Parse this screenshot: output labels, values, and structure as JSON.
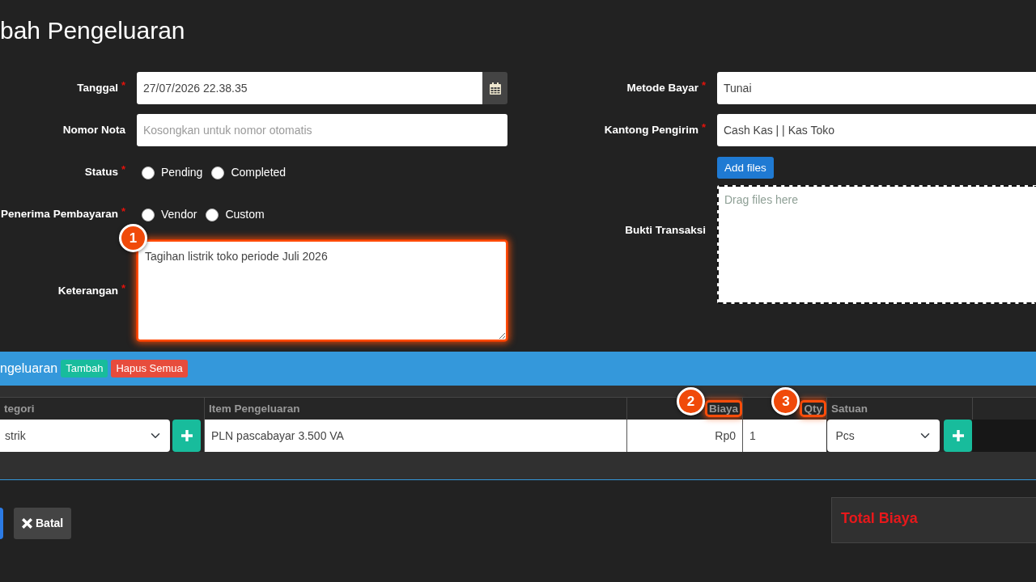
{
  "page_title": "bah Pengeluaran",
  "form_left": [
    {
      "kind": "datetime",
      "label": "Tanggal",
      "required_mark": "*",
      "value": "27/07/2026 22.38.35"
    },
    {
      "kind": "text",
      "label": "Nomor Nota",
      "placeholder": "Kosongkan untuk nomor otomatis"
    },
    {
      "kind": "radio",
      "label": "Status",
      "required_mark": "*",
      "options": [
        {
          "label": "Pending",
          "selected": false
        },
        {
          "label": "Completed",
          "selected": false
        }
      ]
    },
    {
      "kind": "radio",
      "label": "Penerima Pembayaran",
      "required_mark": "*",
      "options": [
        {
          "label": "Vendor",
          "selected": false
        },
        {
          "label": "Custom",
          "selected": false
        }
      ]
    },
    {
      "kind": "textarea",
      "label": "Keterangan",
      "required_mark": "*",
      "value": "Tagihan listrik toko periode Juli 2026",
      "callout": "1"
    }
  ],
  "form_right": [
    {
      "kind": "text",
      "label": "Metode Bayar",
      "required_mark": "*",
      "value": "Tunai"
    },
    {
      "kind": "text",
      "label": "Kantong Pengirim",
      "required_mark": "*",
      "value": "Cash Kas | | Kas Toko"
    },
    {
      "kind": "upload",
      "label": "Bukti Transaksi",
      "button": "Add files",
      "hint": "Drag files here"
    }
  ],
  "items_panel": {
    "title": "ngeluaran",
    "buttons": [
      {
        "kind": "add",
        "label": "Tambah"
      },
      {
        "kind": "delete",
        "label": "Hapus Semua"
      }
    ],
    "columns": [
      {
        "label": "tegori"
      },
      {
        "label": "Item Pengeluaran"
      },
      {
        "label": "Biaya",
        "callout": "2"
      },
      {
        "label": "Qty",
        "callout": "3"
      },
      {
        "label": "Satuan"
      }
    ],
    "rows": [
      {
        "category": "strik",
        "item": "PLN pascabayar 3.500 VA",
        "cost": "Rp0",
        "qty": "1",
        "unit": "Pcs"
      }
    ]
  },
  "actions": [
    {
      "kind": "primary"
    },
    {
      "kind": "secondary",
      "label": "Batal"
    }
  ],
  "total_panel": {
    "label": "Total Biaya"
  }
}
